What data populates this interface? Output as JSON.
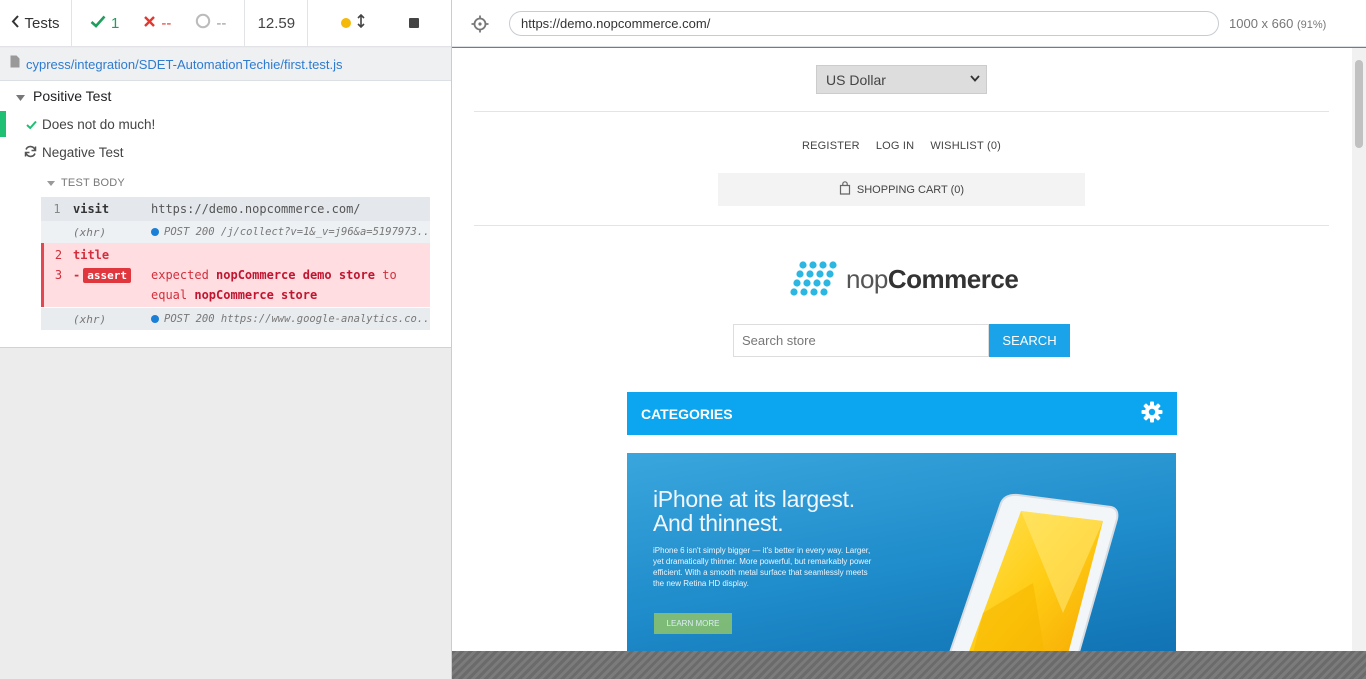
{
  "reporter": {
    "tests_label": "Tests",
    "passed": "1",
    "failed": "--",
    "pending": "--",
    "duration": "12.59",
    "spec_path": "cypress/integration/SDET-AutomationTechie/first.test.js",
    "suite": "Positive Test",
    "test_passed": "Does not do much!",
    "test_running": "Negative Test",
    "test_body_label": "TEST BODY",
    "commands": {
      "visit": {
        "num": "1",
        "name": "visit",
        "msg": "https://demo.nopcommerce.com/"
      },
      "xhr1": {
        "name": "(xhr)",
        "msg": "POST 200 /j/collect?v=1&_v=j96&a=5197973..."
      },
      "title": {
        "num": "2",
        "name": "title"
      },
      "assert": {
        "num": "3",
        "name": "-",
        "badge": "assert",
        "expected": "expected",
        "value1": "nopCommerce demo store",
        "to": "to",
        "equal": "equal",
        "value2": "nopCommerce store"
      },
      "xhr2": {
        "name": "(xhr)",
        "msg": "POST 200 https://www.google-analytics.co..."
      }
    }
  },
  "aut": {
    "url": "https://demo.nopcommerce.com/",
    "viewport": "1000 x 660",
    "zoom": "(91%)",
    "site": {
      "currency": "US Dollar",
      "links": [
        "REGISTER",
        "LOG IN",
        "WISHLIST (0)"
      ],
      "cart": "SHOPPING CART (0)",
      "logo_light": "nop",
      "logo_bold": "Commerce",
      "search_placeholder": "Search store",
      "search_button": "SEARCH",
      "categories": "CATEGORIES",
      "banner_head_1": "iPhone at its largest.",
      "banner_head_2": "And thinnest.",
      "banner_desc": "iPhone 6 isn't simply bigger — it's better in every way. Larger, yet dramatically thinner. More powerful, but remarkably power efficient. With a smooth metal surface that seamlessly meets the new Retina HD display.",
      "banner_button": "LEARN MORE"
    }
  },
  "colors": {
    "pass": "#1f9e5c",
    "fail": "#e3372f",
    "accent": "#0ba6ef"
  }
}
